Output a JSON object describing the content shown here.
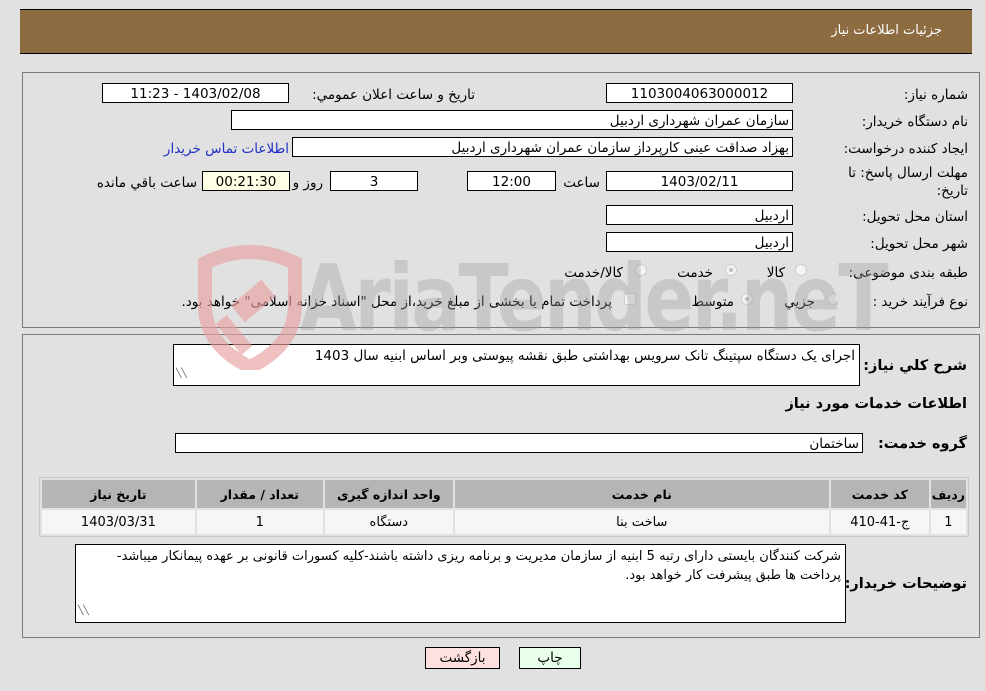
{
  "header": {
    "title": "جزئیات اطلاعات نیاز"
  },
  "details": {
    "need_number_label": "شماره نیاز:",
    "need_number": "1103004063000012",
    "announce_label": "تاریخ و ساعت اعلان عمومي:",
    "announce_value": "1403/02/08 - 11:23",
    "buyer_org_label": "نام دستگاه خريدار:",
    "buyer_org": "سازمان عمران شهرداری اردبیل",
    "requester_label": "ایجاد کننده درخواست:",
    "requester": "بهزاد  صداقت عینی کارپرداز سازمان عمران شهرداری اردبیل",
    "contact_link": "اطلاعات تماس خریدار",
    "deadline_label_line1": "مهلت ارسال پاسخ: تا",
    "deadline_label_line2": "تاریخ:",
    "deadline_date": "1403/02/11",
    "time_label": "ساعت",
    "deadline_time": "12:00",
    "days_value": "3",
    "days_label": "روز و",
    "remaining_time": "00:21:30",
    "remaining_label": "ساعت باقي مانده",
    "province_label": "استان محل تحویل:",
    "province": "اردبیل",
    "city_label": "شهر محل تحویل:",
    "city": "اردبیل",
    "category_label": "طبقه بندی موضوعی:",
    "category_options": [
      {
        "label": "کالا",
        "selected": false
      },
      {
        "label": "خدمت",
        "selected": true
      },
      {
        "label": "کالا/خدمت",
        "selected": false
      }
    ],
    "process_label": "نوع فرآیند خرید :",
    "process_options": [
      {
        "label": "جزيي",
        "selected": false
      },
      {
        "label": "متوسط",
        "selected": true
      }
    ],
    "treasury_checkbox_label": "پرداخت تمام یا بخشی از مبلغ خرید،از محل \"اسناد خزانه اسلامی\" خواهد بود.",
    "treasury_checked": false
  },
  "summary": {
    "description_label": "شرح کلي نياز:",
    "description": "اجرای یک دستگاه سپتینگ تانک سرویس بهداشتی طبق نقشه پیوستی وبر اساس ابنیه سال 1403",
    "services_heading": "اطلاعات خدمات مورد نياز",
    "service_group_label": "گروه خدمت:",
    "service_group": "ساختمان"
  },
  "table": {
    "columns": [
      "ردیف",
      "کد خدمت",
      "نام خدمت",
      "واحد اندازه گیری",
      "تعداد / مقدار",
      "تاریخ نیاز"
    ],
    "rows": [
      [
        "1",
        "ج-41-410",
        "ساخت بنا",
        "دستگاه",
        "1",
        "1403/03/31"
      ]
    ]
  },
  "buyer_notes": {
    "label": "توضیحات خریدار:",
    "text": "شرکت کنندگان بایستی دارای رتبه 5 ابنیه از سازمان مدیریت و برنامه ریزی داشته باشند-کلیه کسورات قانونی بر عهده پیمانکار میباشد-پرداخت ها طبق پیشرفت کار خواهد بود."
  },
  "buttons": {
    "print": "چاپ",
    "back": "بازگشت"
  },
  "watermark": {
    "text": "AriaTender.neT"
  },
  "colors": {
    "header_bg": "#8d6c42",
    "link": "#1f2fc6",
    "back_btn": "#ffe0e0",
    "print_btn": "#eaffea"
  }
}
